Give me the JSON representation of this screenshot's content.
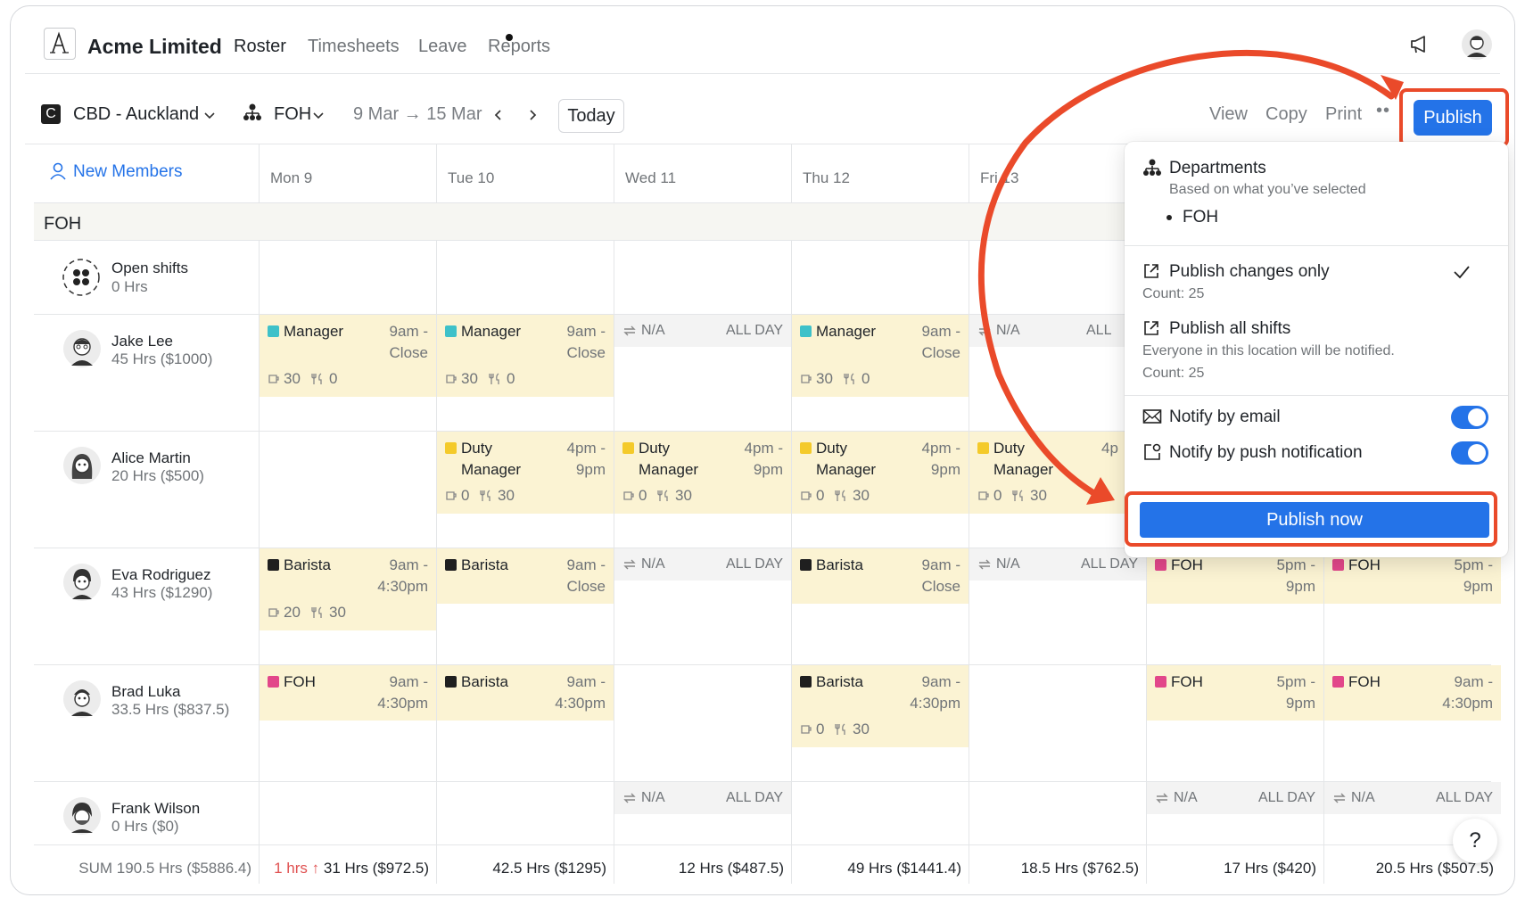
{
  "app": {
    "company": "Acme Limited",
    "nav": [
      "Roster",
      "Timesheets",
      "Leave",
      "Reports"
    ]
  },
  "toolbar": {
    "location_badge": "C",
    "location": "CBD - Auckland",
    "department": "FOH",
    "date_range": "9 Mar → 15 Mar",
    "today": "Today",
    "view": "View",
    "copy": "Copy",
    "print": "Print",
    "more": "••",
    "publish": "Publish"
  },
  "grid": {
    "new_members": "New Members",
    "days": [
      "Mon 9",
      "Tue 10",
      "Wed 11",
      "Thu 12",
      "Fri 13"
    ],
    "section": "FOH",
    "open_shifts": {
      "name": "Open shifts",
      "hours": "0 Hrs"
    },
    "employees": [
      {
        "name": "Jake Lee",
        "hours": "45 Hrs ($1000)"
      },
      {
        "name": "Alice Martin",
        "hours": "20 Hrs ($500)"
      },
      {
        "name": "Eva Rodriguez",
        "hours": "43 Hrs ($1290)"
      },
      {
        "name": "Brad Luka",
        "hours": "33.5 Hrs ($837.5)"
      },
      {
        "name": "Frank Wilson",
        "hours": "0 Hrs ($0)"
      }
    ],
    "labels": {
      "manager": "Manager",
      "duty": "Duty",
      "duty_manager": "Manager",
      "barista": "Barista",
      "foh": "FOH",
      "na": "N/A",
      "all_day": "ALL DAY",
      "all_trunc": "ALL",
      "t_9am": "9am -",
      "t_close": "Close",
      "t_4pm": "4pm -",
      "t_4p": "4p",
      "t_9pm": "9pm",
      "t_5pm": "5pm -",
      "t_430": "4:30pm",
      "n_30": "30",
      "n_0": "0",
      "n_20": "20"
    },
    "footer": {
      "sum": "SUM 190.5 Hrs ($5886.4)",
      "mon_alert": "1 hrs ↑",
      "mon": "31 Hrs ($972.5)",
      "tue": "42.5 Hrs ($1295)",
      "wed": "12 Hrs ($487.5)",
      "thu": "49 Hrs ($1441.4)",
      "fri": "18.5 Hrs ($762.5)",
      "sat": "17 Hrs ($420)",
      "sun": "20.5 Hrs ($507.5)"
    }
  },
  "dropdown": {
    "departments_title": "Departments",
    "departments_sub": "Based on what you’ve selected",
    "department_item": "FOH",
    "changes_title": "Publish changes only",
    "changes_count": "Count: 25",
    "all_title": "Publish all shifts",
    "all_sub": "Everyone in this location will be notified.",
    "all_count": "Count: 25",
    "notify_email": "Notify by email",
    "notify_push": "Notify by push notification",
    "publish_now": "Publish now"
  },
  "help": "?",
  "colors": {
    "accent": "#2473e8",
    "highlight": "#ea4a2a",
    "shift_bg": "#fbf3d3",
    "manager": "#3ec1c9",
    "duty_manager": "#f4ca2a",
    "barista": "#1f1f1f",
    "foh": "#e2478a"
  }
}
